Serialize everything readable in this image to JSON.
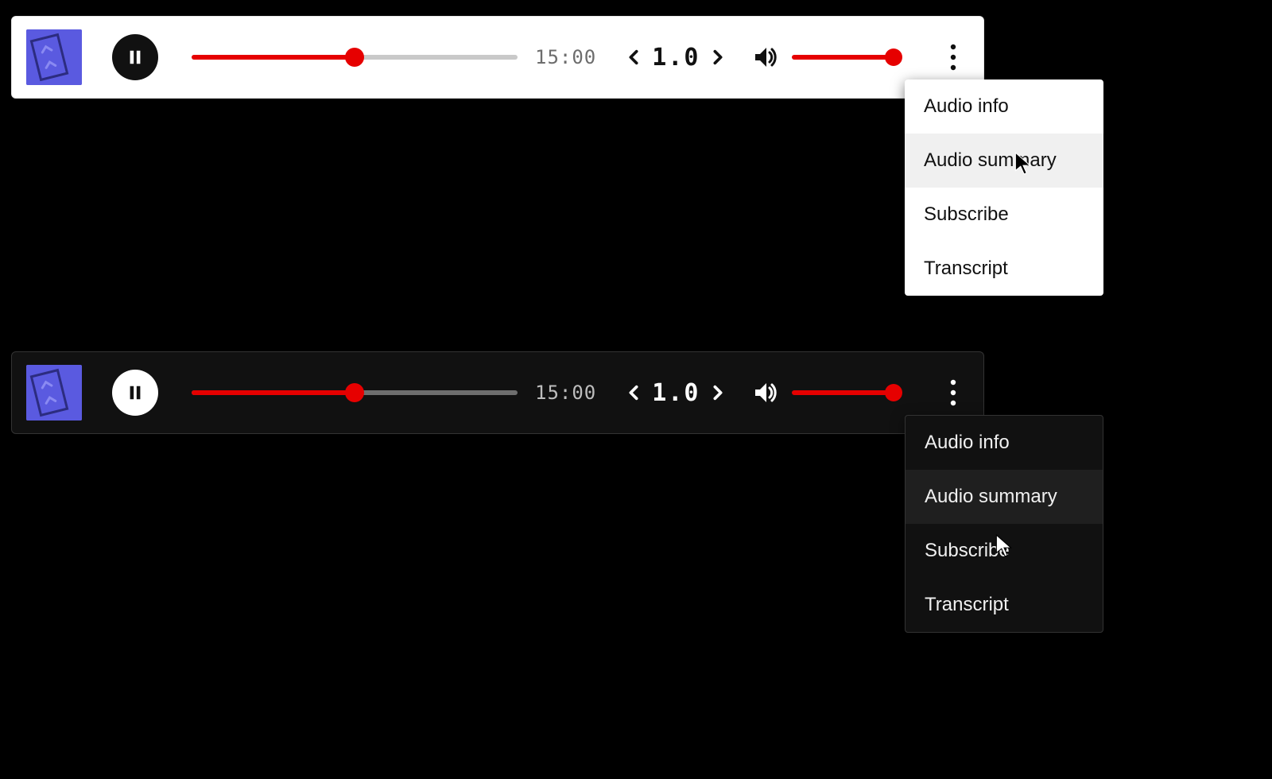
{
  "player": {
    "progress_percent": 50,
    "time_display": "15:00",
    "speed_value": "1.0",
    "volume_percent": 100
  },
  "menu": {
    "items": [
      {
        "label": "Audio info"
      },
      {
        "label": "Audio summary"
      },
      {
        "label": "Subscribe"
      },
      {
        "label": "Transcript"
      }
    ],
    "hover_index": 1
  },
  "colors": {
    "accent": "#e60000"
  }
}
